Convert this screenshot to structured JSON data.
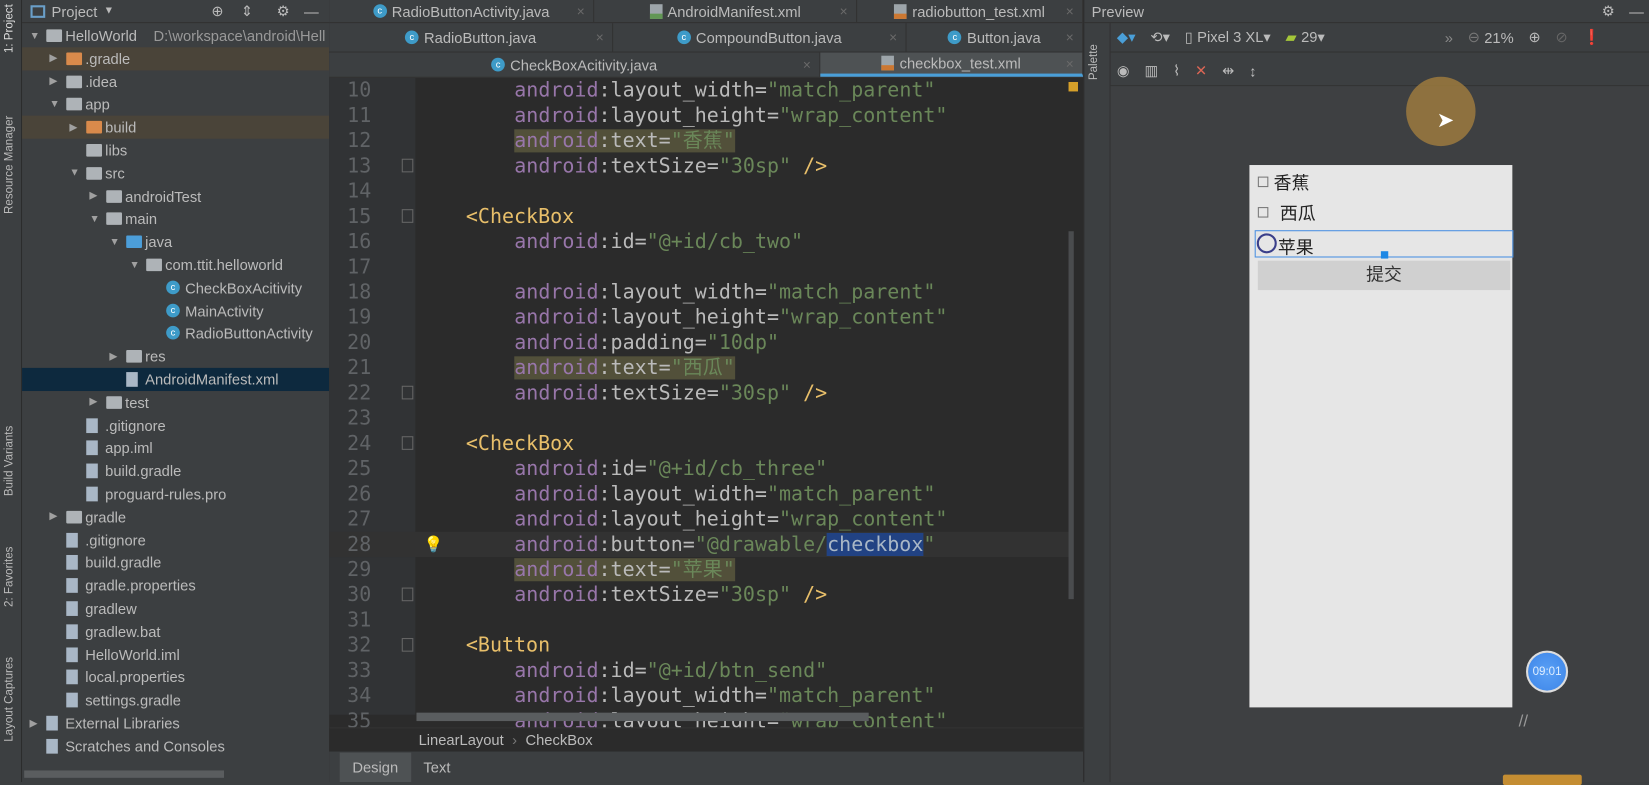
{
  "side_tools": [
    "1: Project",
    "Resource Manager",
    "Build Variants",
    "2: Favorites",
    "Layout Captures"
  ],
  "project": {
    "title": "Project",
    "tree": [
      {
        "level": 0,
        "arrow": "open",
        "icon": "module",
        "label": "HelloWorld",
        "extra": "D:\\workspace\\android\\Hell"
      },
      {
        "level": 1,
        "arrow": "closed",
        "icon": "folder-orange",
        "label": ".gradle",
        "state": "highlight"
      },
      {
        "level": 1,
        "arrow": "closed",
        "icon": "folder",
        "label": ".idea"
      },
      {
        "level": 1,
        "arrow": "open",
        "icon": "folder",
        "label": "app"
      },
      {
        "level": 2,
        "arrow": "closed",
        "icon": "folder-orange",
        "label": "build",
        "state": "highlight"
      },
      {
        "level": 2,
        "arrow": "",
        "icon": "folder",
        "label": "libs"
      },
      {
        "level": 2,
        "arrow": "open",
        "icon": "folder",
        "label": "src"
      },
      {
        "level": 3,
        "arrow": "closed",
        "icon": "folder",
        "label": "androidTest"
      },
      {
        "level": 3,
        "arrow": "open",
        "icon": "folder",
        "label": "main"
      },
      {
        "level": 4,
        "arrow": "open",
        "icon": "folder-blue",
        "label": "java"
      },
      {
        "level": 5,
        "arrow": "open",
        "icon": "folder",
        "label": "com.ttit.helloworld"
      },
      {
        "level": 6,
        "arrow": "",
        "icon": "class",
        "label": "CheckBoxAcitivity"
      },
      {
        "level": 6,
        "arrow": "",
        "icon": "class",
        "label": "MainActivity"
      },
      {
        "level": 6,
        "arrow": "",
        "icon": "class",
        "label": "RadioButtonActivity"
      },
      {
        "level": 4,
        "arrow": "closed",
        "icon": "folder",
        "label": "res"
      },
      {
        "level": 4,
        "arrow": "",
        "icon": "file",
        "label": "AndroidManifest.xml",
        "state": "selected"
      },
      {
        "level": 3,
        "arrow": "closed",
        "icon": "folder",
        "label": "test"
      },
      {
        "level": 2,
        "arrow": "",
        "icon": "file",
        "label": ".gitignore"
      },
      {
        "level": 2,
        "arrow": "",
        "icon": "file",
        "label": "app.iml"
      },
      {
        "level": 2,
        "arrow": "",
        "icon": "file",
        "label": "build.gradle"
      },
      {
        "level": 2,
        "arrow": "",
        "icon": "file",
        "label": "proguard-rules.pro"
      },
      {
        "level": 1,
        "arrow": "closed",
        "icon": "folder",
        "label": "gradle"
      },
      {
        "level": 1,
        "arrow": "",
        "icon": "file",
        "label": ".gitignore"
      },
      {
        "level": 1,
        "arrow": "",
        "icon": "file",
        "label": "build.gradle"
      },
      {
        "level": 1,
        "arrow": "",
        "icon": "file",
        "label": "gradle.properties"
      },
      {
        "level": 1,
        "arrow": "",
        "icon": "file",
        "label": "gradlew"
      },
      {
        "level": 1,
        "arrow": "",
        "icon": "file",
        "label": "gradlew.bat"
      },
      {
        "level": 1,
        "arrow": "",
        "icon": "file",
        "label": "HelloWorld.iml"
      },
      {
        "level": 1,
        "arrow": "",
        "icon": "file",
        "label": "local.properties"
      },
      {
        "level": 1,
        "arrow": "",
        "icon": "file",
        "label": "settings.gradle"
      },
      {
        "level": 0,
        "arrow": "closed",
        "icon": "libraries",
        "label": "External Libraries"
      },
      {
        "level": 0,
        "arrow": "",
        "icon": "scratches",
        "label": "Scratches and Consoles"
      }
    ]
  },
  "tabs": [
    [
      {
        "label": "RadioButtonActivity.java",
        "type": "class"
      },
      {
        "label": "AndroidManifest.xml",
        "type": "manifest"
      },
      {
        "label": "radiobutton_test.xml",
        "type": "xml"
      }
    ],
    [
      {
        "label": "RadioButton.java",
        "type": "class"
      },
      {
        "label": "CompoundButton.java",
        "type": "class"
      },
      {
        "label": "Button.java",
        "type": "class"
      }
    ],
    [
      {
        "label": "CheckBoxAcitivity.java",
        "type": "class"
      },
      {
        "label": "checkbox_test.xml",
        "type": "xml",
        "active": true
      }
    ]
  ],
  "code": [
    {
      "n": "10",
      "ns": "android",
      "attr": "layout_width",
      "value": "match_parent"
    },
    {
      "n": "11",
      "ns": "android",
      "attr": "layout_height",
      "value": "wrap_content"
    },
    {
      "n": "12",
      "ns": "android",
      "attr": "text",
      "value": "香蕉",
      "highlight": true
    },
    {
      "n": "13",
      "ns": "android",
      "attr": "textSize",
      "value": "30sp",
      "close": " />"
    },
    {
      "n": "14"
    },
    {
      "n": "15",
      "tag": "<CheckBox"
    },
    {
      "n": "16",
      "ns": "android",
      "attr": "id",
      "value": "@+id/cb_two"
    },
    {
      "n": "17"
    },
    {
      "n": "18",
      "ns": "android",
      "attr": "layout_width",
      "value": "match_parent"
    },
    {
      "n": "19",
      "ns": "android",
      "attr": "layout_height",
      "value": "wrap_content"
    },
    {
      "n": "20",
      "ns": "android",
      "attr": "padding",
      "value": "10dp"
    },
    {
      "n": "21",
      "ns": "android",
      "attr": "text",
      "value": "西瓜",
      "highlight": true
    },
    {
      "n": "22",
      "ns": "android",
      "attr": "textSize",
      "value": "30sp",
      "close": " />"
    },
    {
      "n": "23"
    },
    {
      "n": "24",
      "tag": "<CheckBox"
    },
    {
      "n": "25",
      "ns": "android",
      "attr": "id",
      "value": "@+id/cb_three"
    },
    {
      "n": "26",
      "ns": "android",
      "attr": "layout_width",
      "value": "match_parent"
    },
    {
      "n": "27",
      "ns": "android",
      "attr": "layout_height",
      "value": "wrap_content"
    },
    {
      "n": "28",
      "ns": "android",
      "attr": "button",
      "value": "@drawable/",
      "selected": "checkbox",
      "current": true
    },
    {
      "n": "29",
      "ns": "android",
      "attr": "text",
      "value": "苹果",
      "highlight": true
    },
    {
      "n": "30",
      "ns": "android",
      "attr": "textSize",
      "value": "30sp",
      "close": " />"
    },
    {
      "n": "31"
    },
    {
      "n": "32",
      "tag": "<Button"
    },
    {
      "n": "33",
      "ns": "android",
      "attr": "id",
      "value": "@+id/btn_send"
    },
    {
      "n": "34",
      "ns": "android",
      "attr": "layout_width",
      "value": "match_parent"
    },
    {
      "n": "35",
      "ns": "android",
      "attr": "layout_height",
      "value": "wrap_content"
    }
  ],
  "breadcrumb": [
    "LinearLayout",
    "CheckBox"
  ],
  "bottom_tabs": [
    "Design",
    "Text"
  ],
  "preview": {
    "title": "Preview",
    "palette": "Palette",
    "device": "Pixel 3 XL",
    "api": "29",
    "zoom": "21%",
    "checkboxes": [
      "香蕉",
      "西瓜",
      "苹果"
    ],
    "button": "提交"
  },
  "clock": "09:01"
}
